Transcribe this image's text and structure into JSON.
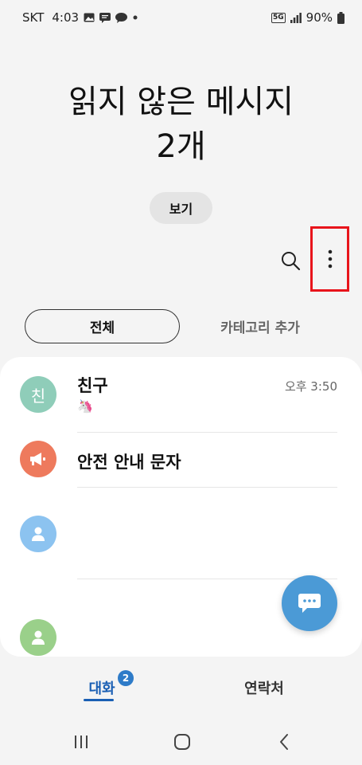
{
  "status_bar": {
    "carrier": "SKT",
    "time": "4:03",
    "network": "5G",
    "battery": "90%",
    "icons_left": [
      "gallery-icon",
      "message-icon",
      "talk-icon",
      "dot-icon"
    ],
    "icons_right": [
      "network-5g-icon",
      "signal-icon",
      "battery-icon"
    ]
  },
  "header": {
    "title_line1": "읽지 않은 메시지",
    "title_line2": "2개",
    "view_button": "보기"
  },
  "toolbar": {
    "icons": [
      "search-icon",
      "more-options-icon"
    ]
  },
  "filter_tabs": {
    "all": "전체",
    "add_category": "카테고리 추가"
  },
  "conversations": [
    {
      "avatar_text": "친",
      "avatar_color": "#8fcdb9",
      "name": "친구",
      "time": "오후 3:50",
      "preview": "🦄"
    },
    {
      "avatar_icon": "megaphone-icon",
      "avatar_color": "#ee7a5d",
      "name": "안전 안내 문자"
    },
    {
      "avatar_icon": "person-icon",
      "avatar_color": "#8cc3f0",
      "name": ""
    },
    {
      "avatar_icon": "person-icon",
      "avatar_color": "#9ad08a",
      "name": ""
    }
  ],
  "fab": {
    "icon": "compose-message-icon",
    "color": "#4b9ad6"
  },
  "bottom_tabs": {
    "conversations": "대화",
    "conversations_badge": "2",
    "contacts": "연락처"
  },
  "nav_bar": {
    "icons": [
      "recent-apps-icon",
      "home-icon",
      "back-icon"
    ]
  },
  "colors": {
    "highlight_box": "#e8141b",
    "accent": "#1a5fb4"
  }
}
